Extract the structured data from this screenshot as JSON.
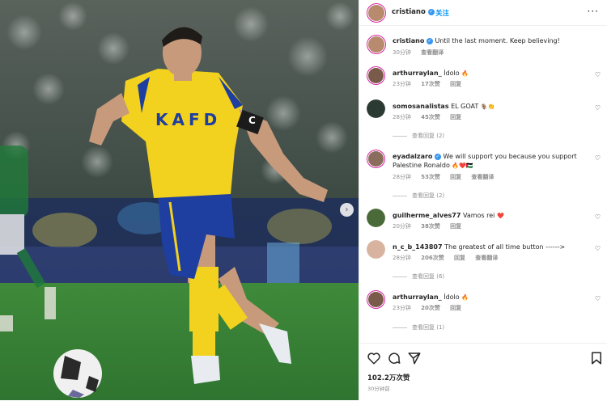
{
  "post": {
    "username": "cristiano",
    "follow_label": "关注",
    "more_icon": "more-icon",
    "caption_user": "cristiano",
    "caption_text": "Until the last moment. Keep believing!",
    "caption_time": "30分钟",
    "caption_translate": "查看翻译",
    "likes": "102.2万次赞",
    "time": "30分钟前"
  },
  "photo": {
    "shirt_text": "KAFD",
    "armband_text": "C"
  },
  "comments": [
    {
      "user": "arthurraylan_",
      "text": "Ídolo",
      "emoji": "🔥",
      "time": "23分钟",
      "likes": "17次赞",
      "reply": "回复",
      "translate": "",
      "avatar_color": "#7a5a4a"
    },
    {
      "user": "somosanalistas",
      "text": "EL GOAT",
      "emoji": "🐐👏",
      "time": "28分钟",
      "likes": "45次赞",
      "reply": "回复",
      "translate": "",
      "view_replies": "查看回复 (2)",
      "avatar_color": "#2b3b33"
    },
    {
      "user": "eyadalzaro",
      "text": "We will support you because you support Palestine Ronaldo",
      "emoji": "🔥❤️🇵🇸",
      "time": "28分钟",
      "likes": "53次赞",
      "reply": "回复",
      "translate": "查看翻译",
      "view_replies": "查看回复 (2)",
      "avatar_color": "#8a6d5c"
    },
    {
      "user": "guilherme_alves77",
      "text": "Vamos rei",
      "emoji": "❤️",
      "time": "20分钟",
      "likes": "38次赞",
      "reply": "回复",
      "translate": "",
      "avatar_color": "#4a6a3a"
    },
    {
      "user": "n_c_b_143807",
      "text": "The greatest of all time button ------>",
      "emoji": "",
      "time": "28分钟",
      "likes": "206次赞",
      "reply": "回复",
      "translate": "查看翻译",
      "view_replies": "查看回复 (6)",
      "avatar_color": "#d8b4a0"
    },
    {
      "user": "arthurraylan_",
      "text": "Ídolo",
      "emoji": "🔥",
      "time": "23分钟",
      "likes": "20次赞",
      "reply": "回复",
      "translate": "",
      "view_replies": "查看回复 (1)",
      "avatar_color": "#7a5a4a"
    }
  ],
  "icons": [
    "heart-icon",
    "comment-icon",
    "share-icon",
    "bookmark-icon"
  ],
  "colors": {
    "accent": "#0095f6",
    "verified": "#3897f0",
    "muted": "#8e8e8e",
    "jersey_yellow": "#f2d21f",
    "shorts_blue": "#1f3fa0"
  }
}
